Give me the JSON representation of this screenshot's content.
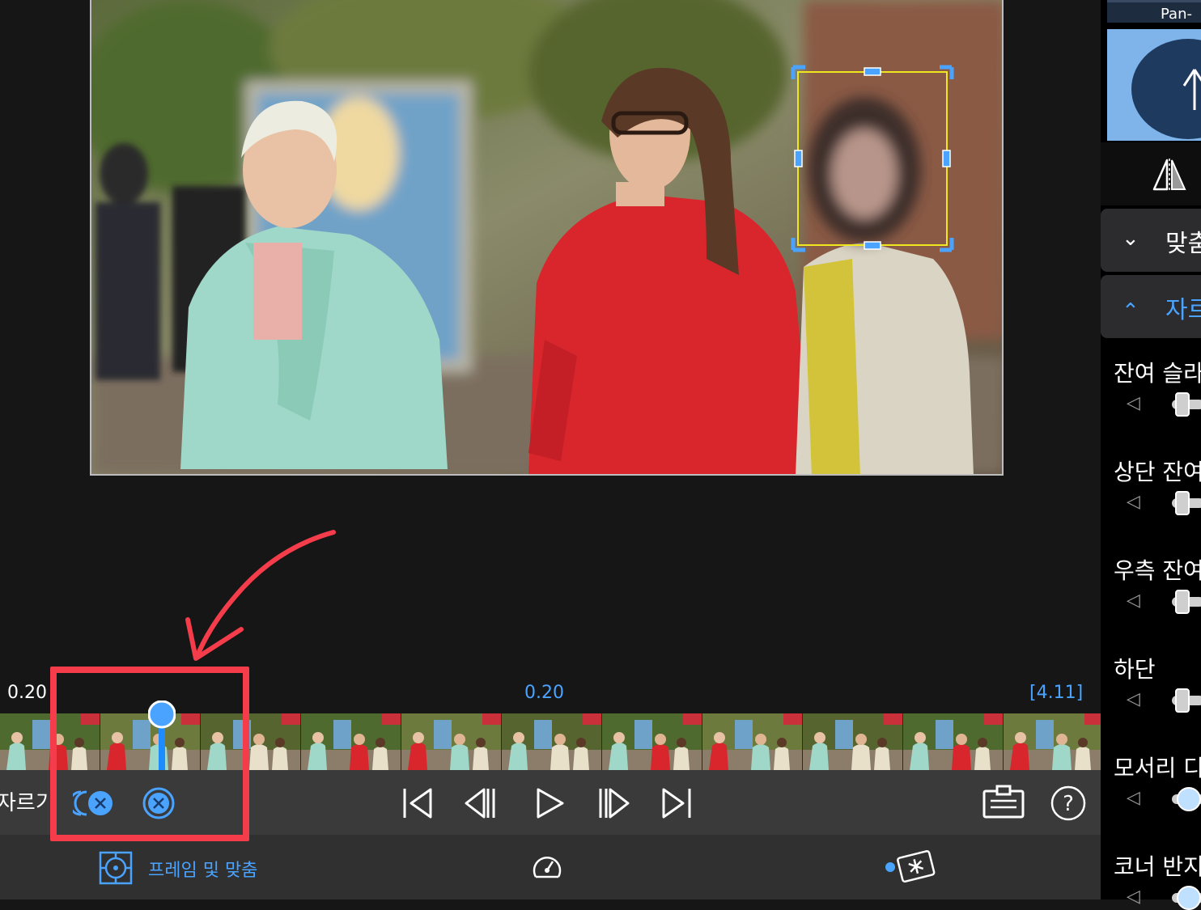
{
  "timeline": {
    "time_left": "0.20",
    "time_center": "0.20",
    "time_right": "[4.11]",
    "playhead_fraction": 0.148
  },
  "toolbar": {
    "crop_label": "자르기",
    "buttons": [
      "remove-all-keyframes",
      "remove-keyframe",
      "go-to-start",
      "previous-frame",
      "play",
      "next-frame",
      "go-to-end",
      "clipboard",
      "help"
    ]
  },
  "bottombar": {
    "frame_fit_label": "프레임 및 맞춤"
  },
  "inspector": {
    "tab_label": "Pan-",
    "fit_section": "맞춤",
    "crop_section": "자르",
    "params": [
      {
        "label": "잔여 슬라",
        "value": 0.2
      },
      {
        "label": "상단 잔여",
        "value": 0.2
      },
      {
        "label": "우측 잔여",
        "value": 0.2
      },
      {
        "label": "하단",
        "value": 0.2
      },
      {
        "label": "모서리 디",
        "value": 0.1
      },
      {
        "label": "코너 반지",
        "value": 0.1
      }
    ]
  },
  "colors": {
    "accent": "#4aa3ff",
    "highlight": "#f43c4a",
    "crop_box": "#f0e81e"
  }
}
